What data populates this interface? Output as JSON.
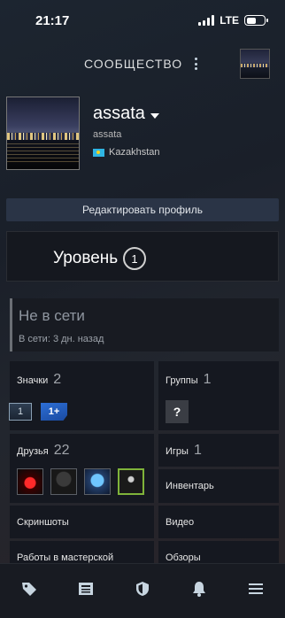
{
  "status_bar": {
    "time": "21:17",
    "network": "LTE"
  },
  "header": {
    "title": "СООБЩЕСТВО",
    "more_icon": "more-vertical-icon"
  },
  "profile": {
    "name": "assata",
    "real_name": "assata",
    "country": "Kazakhstan",
    "edit_button": "Редактировать профиль"
  },
  "level": {
    "label": "Уровень",
    "value": "1"
  },
  "status": {
    "main": "Не в сети",
    "last_seen": "В сети: 3 дн. назад"
  },
  "sections": {
    "badges": {
      "label": "Значки",
      "count": "2",
      "items": [
        "1",
        "1+"
      ]
    },
    "groups": {
      "label": "Группы",
      "count": "1",
      "placeholder": "?"
    },
    "friends": {
      "label": "Друзья",
      "count": "22"
    },
    "games": {
      "label": "Игры",
      "count": "1"
    },
    "inventory": {
      "label": "Инвентарь"
    },
    "screenshots": {
      "label": "Скриншоты"
    },
    "videos": {
      "label": "Видео"
    },
    "workshop": {
      "label": "Работы в мастерской"
    },
    "reviews": {
      "label": "Обзоры"
    }
  },
  "tabbar": [
    "tag-icon",
    "news-icon",
    "shield-icon",
    "bell-icon",
    "menu-icon"
  ]
}
